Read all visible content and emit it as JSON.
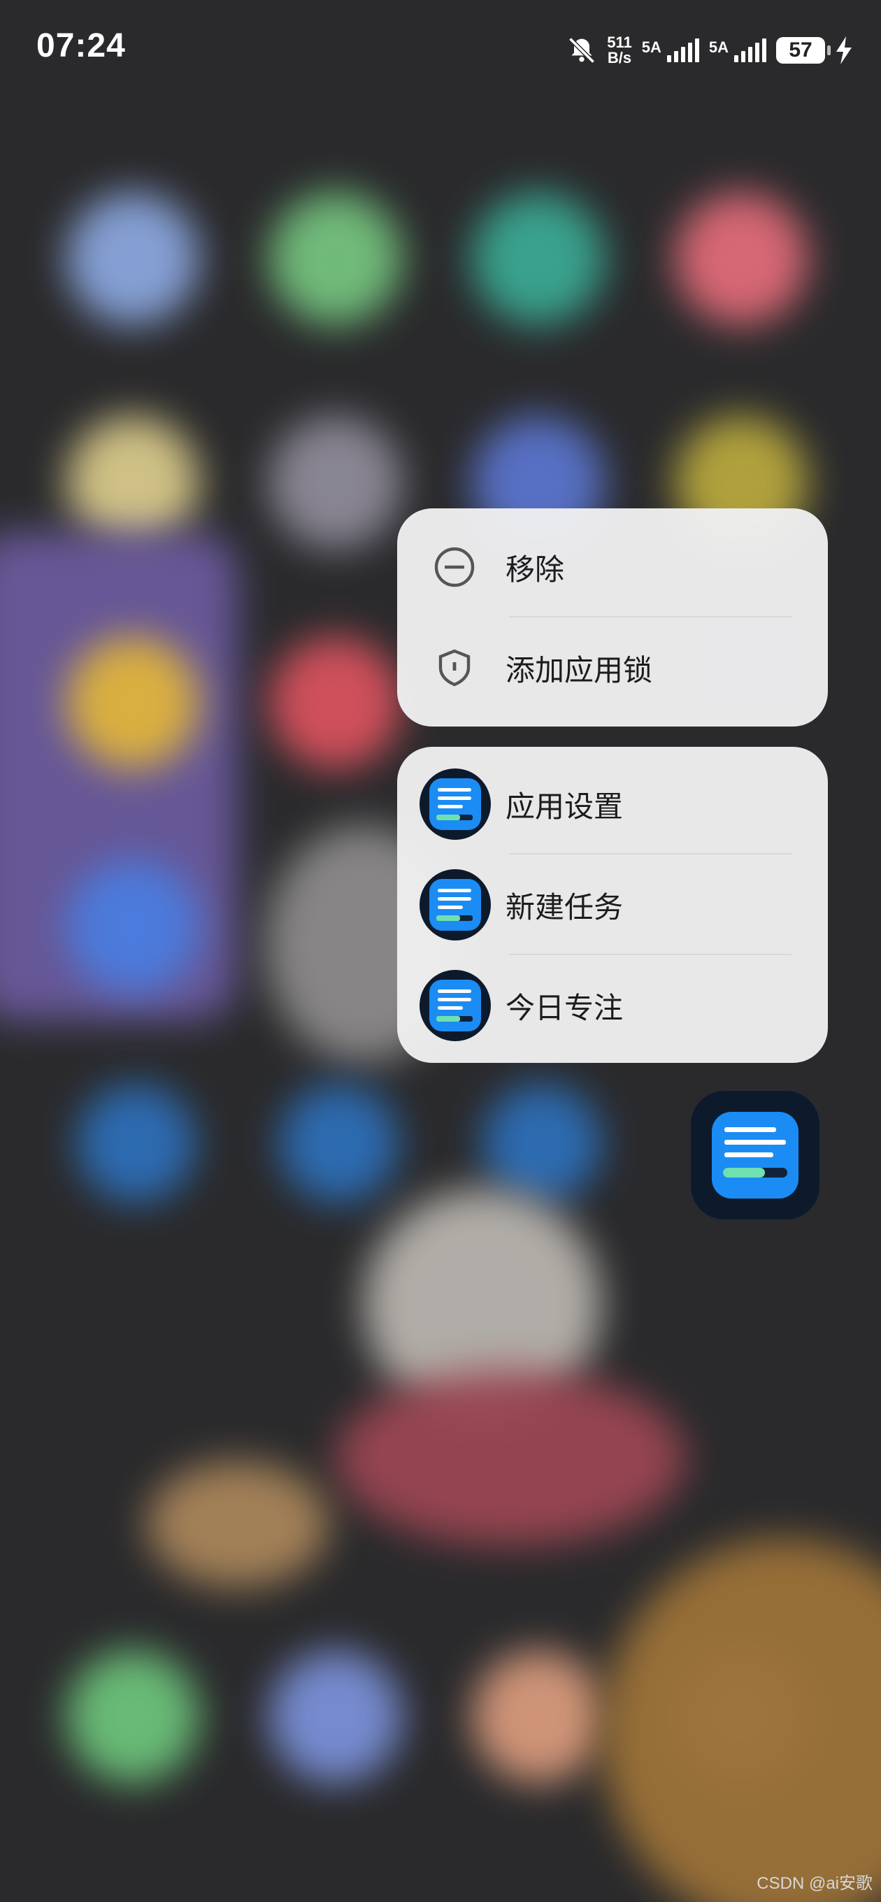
{
  "status_bar": {
    "time": "07:24",
    "net_speed_top": "511",
    "net_speed_bottom": "B/s",
    "signal1_label": "5A",
    "signal2_label": "5A",
    "battery": "57",
    "icons": [
      "bell-mute-icon",
      "signal-icon",
      "signal-icon",
      "battery-icon",
      "charging-icon"
    ]
  },
  "context_menu": {
    "system_actions": [
      {
        "label": "移除",
        "icon": "minus-circle-icon"
      },
      {
        "label": "添加应用锁",
        "icon": "shield-lock-icon"
      }
    ],
    "shortcuts": [
      {
        "label": "应用设置",
        "icon": "app-icon"
      },
      {
        "label": "新建任务",
        "icon": "app-icon"
      },
      {
        "label": "今日专注",
        "icon": "app-icon"
      }
    ]
  },
  "watermark": "CSDN @ai安歌",
  "colors": {
    "app_icon_bg": "#0d1a2c",
    "app_icon_blue": "#1b8cf3",
    "progress_green": "#6fe0b0",
    "menu_bg": "#eeeef0"
  }
}
